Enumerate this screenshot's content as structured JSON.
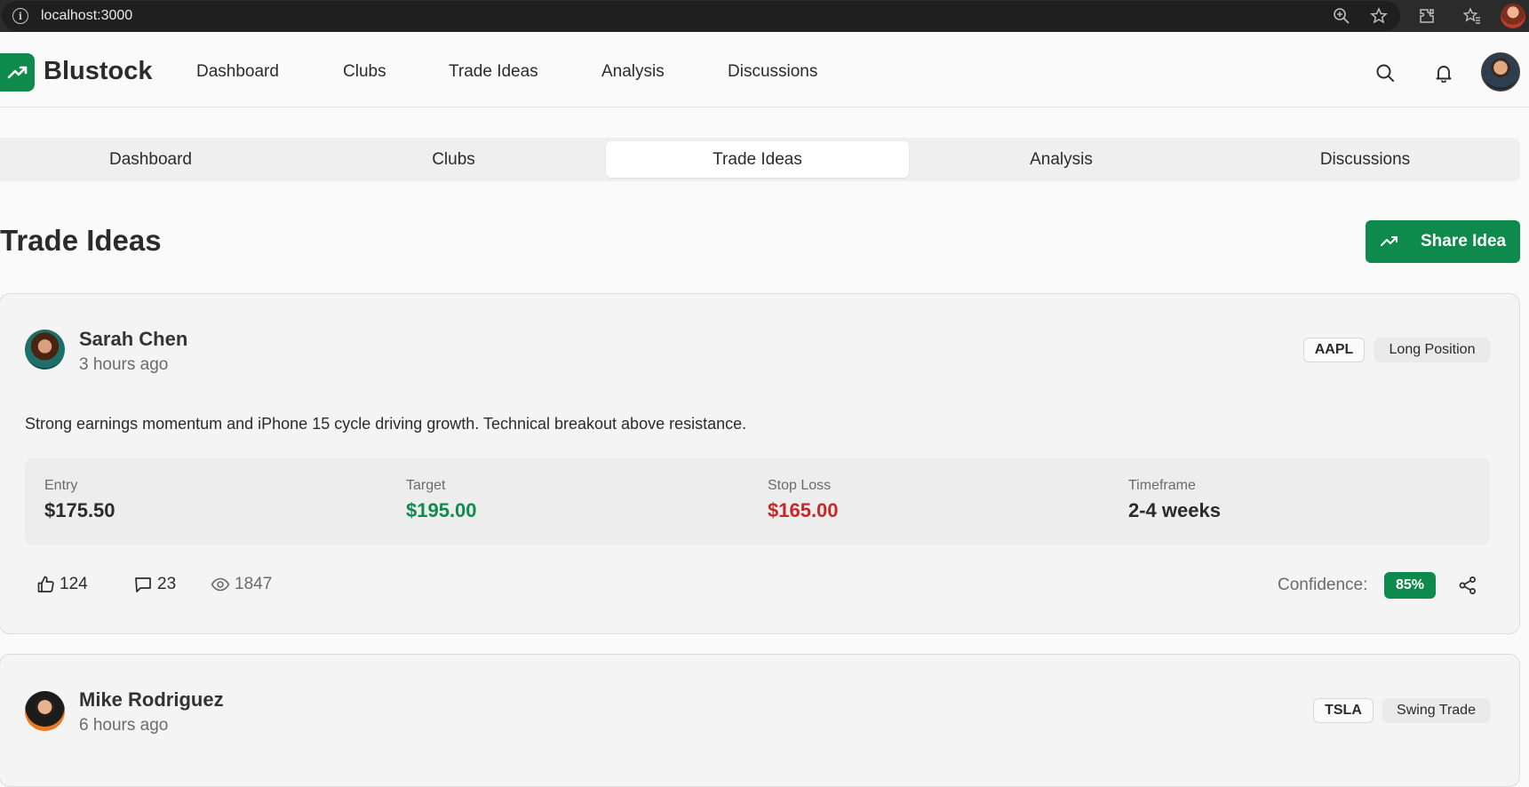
{
  "browser": {
    "url": "localhost:3000"
  },
  "app": {
    "name": "Blustock",
    "nav": [
      "Dashboard",
      "Clubs",
      "Trade Ideas",
      "Analysis",
      "Discussions"
    ]
  },
  "tabs": {
    "items": [
      "Dashboard",
      "Clubs",
      "Trade Ideas",
      "Analysis",
      "Discussions"
    ],
    "active": "Trade Ideas"
  },
  "page": {
    "title": "Trade Ideas",
    "share_button": "Share Idea"
  },
  "ideas": [
    {
      "author": "Sarah Chen",
      "time": "3 hours ago",
      "ticker": "AAPL",
      "position": "Long Position",
      "description": "Strong earnings momentum and iPhone 15 cycle driving growth. Technical breakout above resistance.",
      "metrics": {
        "entry_label": "Entry",
        "entry": "$175.50",
        "target_label": "Target",
        "target": "$195.00",
        "stop_label": "Stop Loss",
        "stop": "$165.00",
        "timeframe_label": "Timeframe",
        "timeframe": "2-4 weeks"
      },
      "likes": "124",
      "comments": "23",
      "views": "1847",
      "confidence_label": "Confidence:",
      "confidence": "85%"
    },
    {
      "author": "Mike Rodriguez",
      "time": "6 hours ago",
      "ticker": "TSLA",
      "position": "Swing Trade"
    }
  ],
  "colors": {
    "brand_green": "#0f8a4d",
    "target_green": "#0f8a4d",
    "stop_red": "#c62828"
  }
}
